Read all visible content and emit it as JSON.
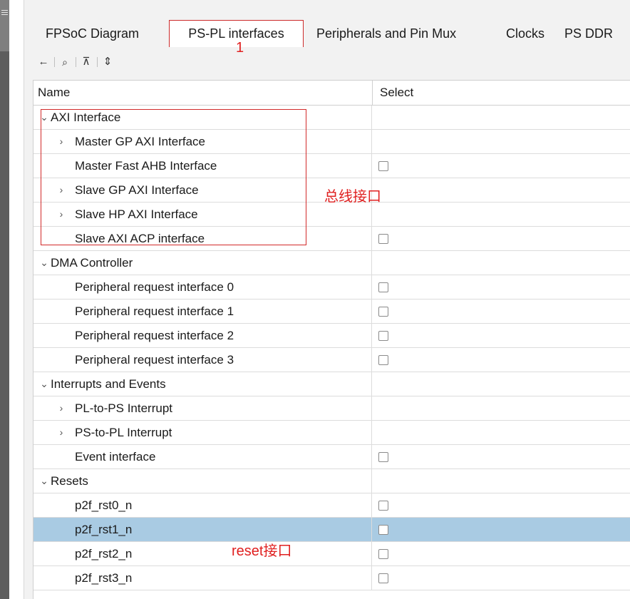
{
  "tabs": [
    {
      "label": "FPSoC Diagram",
      "active": false
    },
    {
      "label": "PS-PL interfaces",
      "active": true
    },
    {
      "label": "Peripherals and Pin Mux",
      "active": false
    },
    {
      "label": "Clocks",
      "active": false
    },
    {
      "label": "PS DDR",
      "active": false
    }
  ],
  "toolbar": {
    "back_icon": "←",
    "search_icon": "⌕",
    "collapse_icon": "⊼",
    "expand_icon": "⇕"
  },
  "table": {
    "columns": [
      "Name",
      "Select"
    ],
    "rows": [
      {
        "label": "AXI Interface",
        "level": 0,
        "toggle": "⌄",
        "checkbox": false,
        "selected": false
      },
      {
        "label": "Master GP AXI Interface",
        "level": 1,
        "toggle": "›",
        "checkbox": false,
        "selected": false
      },
      {
        "label": "Master Fast AHB Interface",
        "level": 1,
        "toggle": "",
        "checkbox": true,
        "selected": false
      },
      {
        "label": "Slave GP AXI Interface",
        "level": 1,
        "toggle": "›",
        "checkbox": false,
        "selected": false
      },
      {
        "label": "Slave HP AXI Interface",
        "level": 1,
        "toggle": "›",
        "checkbox": false,
        "selected": false
      },
      {
        "label": "Slave AXI ACP interface",
        "level": 1,
        "toggle": "",
        "checkbox": true,
        "selected": false
      },
      {
        "label": "DMA Controller",
        "level": 0,
        "toggle": "⌄",
        "checkbox": false,
        "selected": false
      },
      {
        "label": "Peripheral request interface 0",
        "level": 1,
        "toggle": "",
        "checkbox": true,
        "selected": false
      },
      {
        "label": "Peripheral request interface 1",
        "level": 1,
        "toggle": "",
        "checkbox": true,
        "selected": false
      },
      {
        "label": "Peripheral request interface 2",
        "level": 1,
        "toggle": "",
        "checkbox": true,
        "selected": false
      },
      {
        "label": "Peripheral request interface 3",
        "level": 1,
        "toggle": "",
        "checkbox": true,
        "selected": false
      },
      {
        "label": "Interrupts and Events",
        "level": 0,
        "toggle": "⌄",
        "checkbox": false,
        "selected": false
      },
      {
        "label": "PL-to-PS Interrupt",
        "level": 1,
        "toggle": "›",
        "checkbox": false,
        "selected": false
      },
      {
        "label": "PS-to-PL Interrupt",
        "level": 1,
        "toggle": "›",
        "checkbox": false,
        "selected": false
      },
      {
        "label": "Event interface",
        "level": 1,
        "toggle": "",
        "checkbox": true,
        "selected": false
      },
      {
        "label": "Resets",
        "level": 0,
        "toggle": "⌄",
        "checkbox": false,
        "selected": false
      },
      {
        "label": "p2f_rst0_n",
        "level": 1,
        "toggle": "",
        "checkbox": true,
        "selected": false
      },
      {
        "label": "p2f_rst1_n",
        "level": 1,
        "toggle": "",
        "checkbox": true,
        "selected": true
      },
      {
        "label": "p2f_rst2_n",
        "level": 1,
        "toggle": "",
        "checkbox": true,
        "selected": false
      },
      {
        "label": "p2f_rst3_n",
        "level": 1,
        "toggle": "",
        "checkbox": true,
        "selected": false
      }
    ]
  },
  "annotations": {
    "tab_marker": "1",
    "bus_interface": "总线接口",
    "reset_interface": "reset接口"
  },
  "colors": {
    "annotation_red": "#e02020",
    "selected_row": "#a9cbe3"
  }
}
